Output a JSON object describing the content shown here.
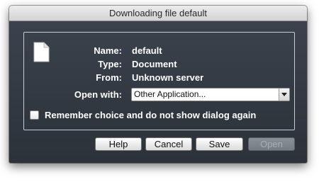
{
  "window": {
    "title": "Downloading file default"
  },
  "details": {
    "name_label": "Name:",
    "name_value": "default",
    "type_label": "Type:",
    "type_value": "Document",
    "from_label": "From:",
    "from_value": "Unknown server",
    "open_with_label": "Open with:",
    "open_with_value": "Other Application..."
  },
  "remember": {
    "label": "Remember choice and do not show dialog again",
    "checked": false
  },
  "buttons": {
    "help": "Help",
    "cancel": "Cancel",
    "save": "Save",
    "open": "Open"
  },
  "icons": {
    "file": "document-icon",
    "dropdown": "dropdown-arrow-icon"
  }
}
